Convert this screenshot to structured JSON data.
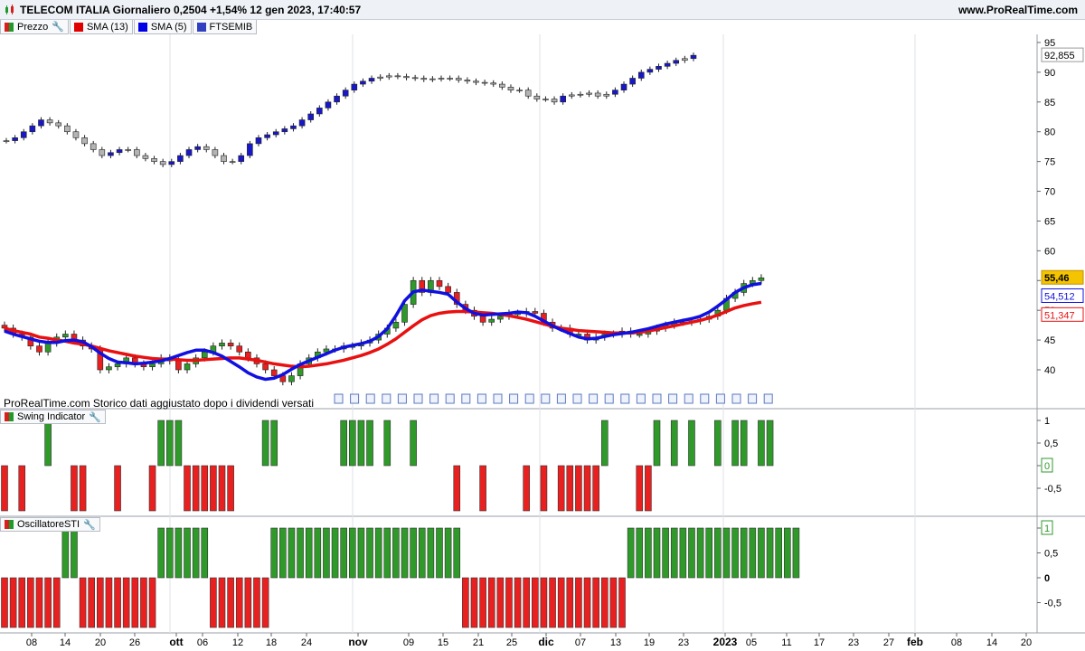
{
  "header": {
    "title": "TELECOM ITALIA Giornaliero 0,2504 +1,54% 12 gen 2023, 17:40:57",
    "site": "www.ProRealTime.com"
  },
  "legend": [
    {
      "label": "Prezzo",
      "color": "#d62020",
      "color2": "#1f9a2a"
    },
    {
      "label": "SMA (13)",
      "color": "#e00000"
    },
    {
      "label": "SMA (5)",
      "color": "#0000e6"
    },
    {
      "label": "FTSEMIB",
      "color": "#3040c0"
    }
  ],
  "footnote": "ProRealTime.com Storico dati aggiustato dopo i dividendi versati",
  "panels": {
    "swing_label": "Swing Indicator",
    "sti_label": "OscillatoreSTI"
  },
  "colors": {
    "up": "#2f9a2a",
    "down": "#e82020",
    "ftse_up": "#1818c8",
    "ftse_flat": "#b4b4b4",
    "sma13": "#e81010",
    "sma5": "#1010e0",
    "price_box": "#f5c400"
  },
  "chart_data": [
    {
      "type": "candlestick",
      "name": "main",
      "ylim": [
        35,
        97
      ],
      "yticks": [
        "95",
        "90",
        "85",
        "80",
        "75",
        "70",
        "65",
        "60",
        "55",
        "50",
        "45",
        "40"
      ],
      "current_labels": {
        "price": "55,46",
        "sma5": "54,512",
        "sma13": "51,347",
        "ftse": "92,855"
      },
      "x_ticks": [
        "08",
        "14",
        "20",
        "26",
        "ott",
        "06",
        "12",
        "18",
        "24",
        "nov",
        "09",
        "15",
        "21",
        "25",
        "dic",
        "07",
        "13",
        "19",
        "23",
        "2023",
        "05",
        "11",
        "17",
        "23",
        "27",
        "feb",
        "08",
        "14",
        "20"
      ],
      "series": [
        {
          "name": "Prezzo",
          "kind": "candles"
        },
        {
          "name": "SMA (13)",
          "kind": "line"
        },
        {
          "name": "SMA (5)",
          "kind": "line"
        },
        {
          "name": "FTSEMIB",
          "kind": "candles"
        }
      ],
      "price": [
        47,
        46,
        45.5,
        44,
        43,
        44.5,
        45.5,
        46,
        45,
        44,
        43.5,
        40,
        40.5,
        41,
        42,
        41,
        40.5,
        41,
        42,
        41.5,
        40,
        41,
        42,
        43,
        44,
        44.5,
        44,
        43,
        42,
        41,
        40,
        39,
        38,
        39,
        41,
        42,
        43,
        43.5,
        43.5,
        44,
        44,
        44.5,
        45,
        46,
        47,
        48,
        51,
        55,
        53,
        55,
        54,
        53,
        51,
        50,
        49,
        48,
        48.5,
        49,
        49.5,
        49.5,
        49.8,
        49.5,
        48,
        47,
        47,
        46,
        46,
        45,
        45.5,
        46,
        46,
        46.5,
        46,
        46,
        46.5,
        47,
        47.5,
        48,
        48,
        48.2,
        48.5,
        49,
        50,
        52,
        53,
        54.5,
        55,
        55.46
      ],
      "sma13": [
        47,
        46.6,
        46.3,
        46,
        45.5,
        45.3,
        45,
        44.8,
        44.5,
        44.3,
        44,
        43.6,
        43.2,
        42.9,
        42.6,
        42.3,
        42.1,
        41.9,
        41.8,
        41.8,
        41.7,
        41.6,
        41.6,
        41.7,
        41.8,
        41.9,
        42,
        42,
        41.8,
        41.6,
        41.3,
        41,
        40.8,
        40.6,
        40.5,
        40.6,
        40.8,
        41,
        41.3,
        41.6,
        42,
        42.4,
        42.9,
        43.5,
        44.3,
        45.2,
        46.3,
        47.4,
        48.4,
        49.1,
        49.5,
        49.7,
        49.8,
        49.8,
        49.7,
        49.6,
        49.5,
        49.3,
        49.1,
        48.8,
        48.5,
        48.1,
        47.7,
        47.3,
        47,
        46.8,
        46.6,
        46.5,
        46.4,
        46.3,
        46.2,
        46.2,
        46.2,
        46.3,
        46.5,
        46.8,
        47.1,
        47.4,
        47.7,
        48,
        48.3,
        48.7,
        49.2,
        49.8,
        50.4,
        50.8,
        51.1,
        51.347
      ],
      "sma5": [
        46.5,
        46,
        45.6,
        45.2,
        44.8,
        44.6,
        44.6,
        44.9,
        45,
        44.7,
        43.9,
        42.8,
        41.9,
        41.3,
        41.2,
        41,
        41.1,
        41.3,
        41.5,
        41.9,
        42.4,
        42.9,
        43.3,
        43.3,
        42.9,
        42.3,
        41.4,
        40.5,
        39.5,
        38.8,
        38.4,
        38.6,
        39.2,
        40.1,
        40.9,
        41.5,
        42.1,
        42.7,
        43.3,
        43.8,
        44.1,
        44.4,
        44.8,
        45.6,
        46.9,
        49.1,
        51.6,
        53.1,
        53.4,
        53.2,
        53,
        52.7,
        51.4,
        50.3,
        49.5,
        49.2,
        49.3,
        49.4,
        49.5,
        49.7,
        49.6,
        49,
        48.2,
        47.4,
        46.7,
        46.1,
        45.5,
        45.2,
        45.3,
        45.6,
        45.9,
        46.1,
        46.3,
        46.6,
        46.9,
        47.3,
        47.7,
        48,
        48.3,
        48.6,
        49,
        49.7,
        50.7,
        51.8,
        53,
        53.8,
        54.3,
        54.512
      ],
      "ftse": [
        78.5,
        79,
        80,
        81,
        82,
        81.5,
        81,
        80,
        79,
        78,
        77,
        76,
        76.5,
        77,
        77,
        76,
        75.5,
        75,
        74.5,
        75,
        76,
        77,
        77.5,
        77,
        76,
        75,
        75,
        76,
        78,
        79,
        79.5,
        80,
        80.5,
        81,
        82,
        83,
        84,
        85,
        86,
        87,
        88,
        88.5,
        89,
        89.2,
        89.4,
        89.3,
        89.1,
        89,
        88.8,
        88.9,
        89,
        89,
        88.7,
        88.5,
        88.3,
        88.2,
        88,
        87.5,
        87,
        87,
        86,
        85.5,
        85.5,
        85,
        86,
        86.2,
        86.3,
        86.5,
        86,
        86.3,
        87,
        88,
        89,
        90,
        90.5,
        91,
        91.5,
        92,
        92.3,
        92.855
      ]
    },
    {
      "type": "bar",
      "name": "Swing Indicator",
      "ylim": [
        -1,
        1
      ],
      "yticks": [
        "1",
        "0,5",
        "0",
        "-0,5"
      ],
      "current_label": "0",
      "values": [
        -1,
        0,
        -1,
        0,
        0,
        1,
        0,
        0,
        -1,
        -1,
        0,
        0,
        0,
        -1,
        0,
        0,
        0,
        -1,
        1,
        1,
        1,
        -1,
        -1,
        -1,
        -1,
        -1,
        -1,
        0,
        0,
        0,
        1,
        1,
        0,
        0,
        0,
        0,
        0,
        0,
        0,
        1,
        1,
        1,
        1,
        0,
        1,
        0,
        0,
        1,
        0,
        0,
        0,
        0,
        -1,
        0,
        0,
        -1,
        0,
        0,
        0,
        0,
        -1,
        0,
        -1,
        0,
        -1,
        -1,
        -1,
        -1,
        -1,
        1,
        0,
        0,
        0,
        -1,
        -1,
        1,
        0,
        1,
        0,
        1,
        0,
        0,
        1,
        0,
        1,
        1,
        0,
        1,
        1
      ]
    },
    {
      "type": "bar",
      "name": "OscillatoreSTI",
      "ylim": [
        -1,
        1
      ],
      "yticks": [
        "1",
        "0,5",
        "0",
        "-0,5"
      ],
      "current_label": "1",
      "values": [
        -1,
        -1,
        -1,
        -1,
        -1,
        -1,
        -1,
        1,
        1,
        -1,
        -1,
        -1,
        -1,
        -1,
        -1,
        -1,
        -1,
        -1,
        1,
        1,
        1,
        1,
        1,
        1,
        -1,
        -1,
        -1,
        -1,
        -1,
        -1,
        -1,
        1,
        1,
        1,
        1,
        1,
        1,
        1,
        1,
        1,
        1,
        1,
        1,
        1,
        1,
        1,
        1,
        1,
        1,
        1,
        1,
        1,
        1,
        -1,
        -1,
        -1,
        -1,
        -1,
        -1,
        -1,
        -1,
        -1,
        -1,
        -1,
        -1,
        -1,
        -1,
        -1,
        -1,
        -1,
        -1,
        -1,
        1,
        1,
        1,
        1,
        1,
        1,
        1,
        1,
        1,
        1,
        1,
        1,
        1,
        1,
        1,
        1,
        1,
        1,
        1,
        1
      ]
    }
  ]
}
